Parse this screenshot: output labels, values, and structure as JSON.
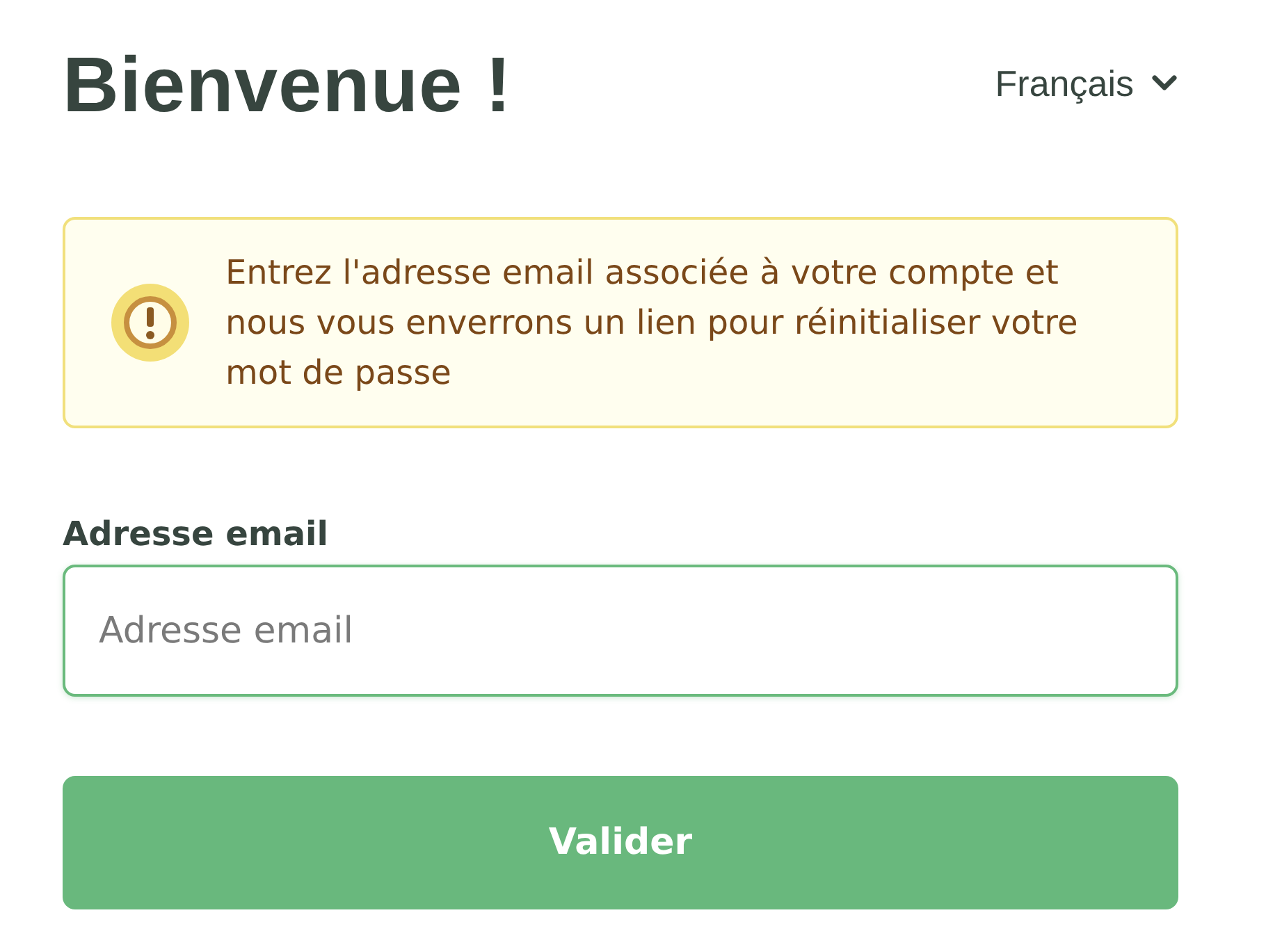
{
  "title": "Bienvenue !",
  "language": {
    "label": "Français"
  },
  "alert": {
    "message": "Entrez l'adresse email associée à votre compte et nous vous enverrons un lien pour réinitialiser votre mot de passe"
  },
  "email_field": {
    "label": "Adresse email",
    "placeholder": "Adresse email",
    "focused": true
  },
  "submit_button": {
    "label": "Valider"
  }
}
